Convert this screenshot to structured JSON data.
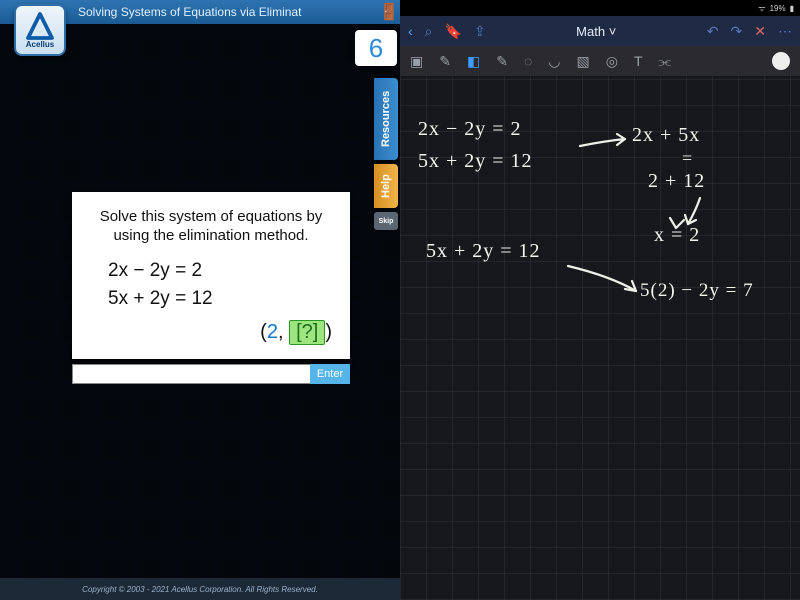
{
  "left": {
    "title": "Solving Systems of Equations via Eliminat",
    "brand": "Acellus",
    "counter": "6",
    "tabs": {
      "resources": "Resources",
      "help": "Help",
      "skip": "Skip"
    },
    "card": {
      "instruction": "Solve this system of equations by using the elimination method.",
      "eq1": "2x − 2y = 2",
      "eq2": "5x + 2y = 12",
      "answer_open": "(",
      "answer_x": "2",
      "answer_sep": ", ",
      "answer_box": "[?]",
      "answer_close": ")"
    },
    "enter_label": "Enter",
    "footer": "Copyright © 2003 - 2021 Acellus Corporation.  All Rights Reserved."
  },
  "right": {
    "status": {
      "battery_pct": "19%"
    },
    "title": "Math",
    "handwriting": {
      "l1": "2x − 2y = 2",
      "l2": "5x + 2y = 12",
      "r1": "2x + 5x",
      "r1eq": "=",
      "r2": "2 + 12",
      "r3": "x = 2",
      "l3": "5x + 2y = 12",
      "r4": "5(2) − 2y = 7"
    }
  }
}
